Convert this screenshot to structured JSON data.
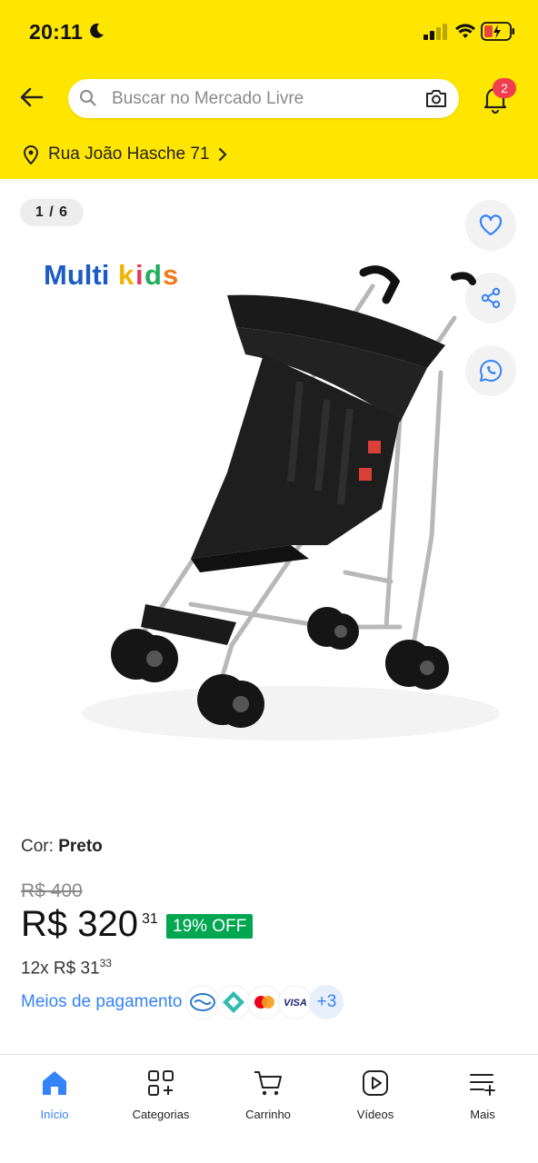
{
  "status_bar": {
    "time": "20:11"
  },
  "search": {
    "placeholder": "Buscar no Mercado Livre"
  },
  "notifications": {
    "badge": "2"
  },
  "address": {
    "text": "Rua João Hasche 71"
  },
  "gallery": {
    "counter": "1 / 6",
    "brand_logo_text": "Multikids"
  },
  "product": {
    "color_label": "Cor:",
    "color_value": "Preto",
    "old_price": "R$ 400",
    "price_main": "R$ 320",
    "price_cents": "31",
    "discount": "19% OFF",
    "installments_prefix": "12x R$ 31",
    "installments_cents": "33"
  },
  "payments": {
    "label": "Meios de pagamento",
    "methods": [
      "mercado-pago-icon",
      "pix-icon",
      "mastercard-icon",
      "visa-icon"
    ],
    "visa_text": "VISA",
    "more": "+3"
  },
  "tabbar": {
    "items": [
      {
        "label": "Início",
        "icon": "home-icon"
      },
      {
        "label": "Categorias",
        "icon": "categories-icon"
      },
      {
        "label": "Carrinho",
        "icon": "cart-icon"
      },
      {
        "label": "Vídeos",
        "icon": "video-icon"
      },
      {
        "label": "Mais",
        "icon": "more-menu-icon"
      }
    ]
  },
  "colors": {
    "header": "#FFE600",
    "accent": "#3483FA",
    "discount": "#00A650",
    "badge": "#F23D4F"
  }
}
